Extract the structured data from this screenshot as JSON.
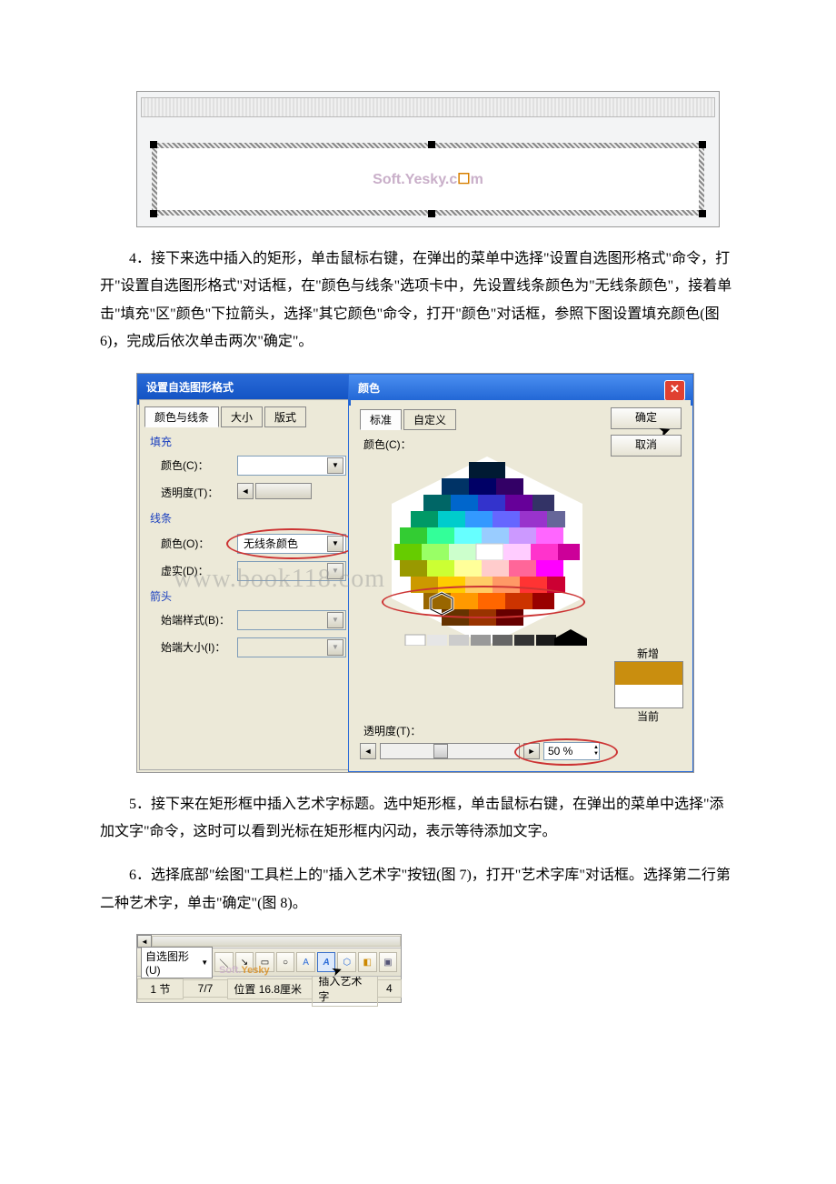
{
  "watermarks": {
    "soft_yesky_1": "Soft.Yesky.c",
    "soft_yesky_2": "m",
    "book118": "www.book118.com",
    "soft_short": "Soft.Yesky"
  },
  "para4": "4．接下来选中插入的矩形，单击鼠标右键，在弹出的菜单中选择\"设置自选图形格式\"命令，打开\"设置自选图形格式\"对话框，在\"颜色与线条\"选项卡中，先设置线条颜色为\"无线条颜色\"，接着单击\"填充\"区\"颜色\"下拉箭头，选择\"其它颜色\"命令，打开\"颜色\"对话框，参照下图设置填充颜色(图 6)，完成后依次单击两次\"确定\"。",
  "para5": "5．接下来在矩形框中插入艺术字标题。选中矩形框，单击鼠标右键，在弹出的菜单中选择\"添加文字\"命令，这时可以看到光标在矩形框内闪动，表示等待添加文字。",
  "para6": "6．选择底部\"绘图\"工具栏上的\"插入艺术字\"按钮(图 7)，打开\"艺术字库\"对话框。选择第二行第二种艺术字，单击\"确定\"(图 8)。",
  "format_dialog": {
    "title": "设置自选图形格式",
    "tabs": {
      "color_lines": "颜色与线条",
      "size": "大小",
      "layout": "版式"
    },
    "fill_section": "填充",
    "fill_color": "颜色(C)：",
    "transparency": "透明度(T)：",
    "line_section": "线条",
    "line_color": "颜色(O)：",
    "line_color_value": "无线条颜色",
    "dashed": "虚实(D)：",
    "arrows_section": "箭头",
    "begin_style": "始端样式(B)：",
    "begin_size": "始端大小(I)："
  },
  "color_dialog": {
    "title": "颜色",
    "tab_standard": "标准",
    "tab_custom": "自定义",
    "ok": "确定",
    "cancel": "取消",
    "colors_label": "颜色(C)：",
    "new_label": "新增",
    "current_label": "当前",
    "transparency_label": "透明度(T)：",
    "transparency_value": "50 %"
  },
  "drawing_toolbar": {
    "autoshapes": "自选图形(U)",
    "tooltip": "插入艺术字"
  },
  "statusbar": {
    "section": "1 节",
    "page": "7/7",
    "position_label": "位置",
    "position_value": "16.8厘米",
    "hint": "插入艺术字",
    "col": "4"
  }
}
